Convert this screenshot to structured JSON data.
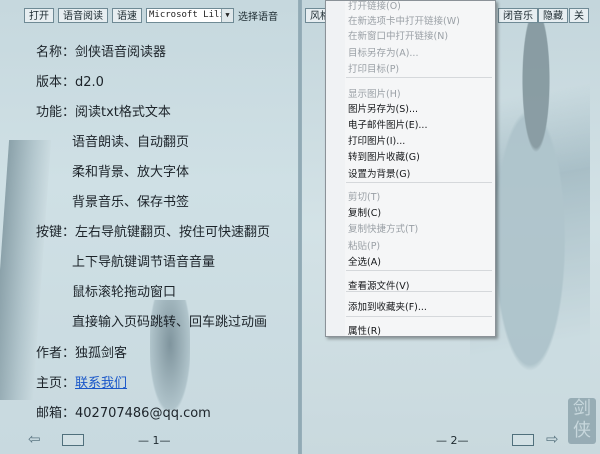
{
  "toolbar_left": {
    "open": "打开",
    "voice_read": "语音阅读",
    "speed": "语速",
    "voice_value": "Microsoft Lili",
    "voice_label": "选择语音"
  },
  "toolbar_right": {
    "style": "风格",
    "music": "闭音乐",
    "hide": "隐藏",
    "close": "关"
  },
  "info": {
    "name": "名称：剑侠语音阅读器",
    "version": "版本：d2.0",
    "features": [
      "功能：阅读txt格式文本",
      "语音朗读、自动翻页",
      "柔和背景、放大字体",
      "背景音乐、保存书签"
    ],
    "keys": [
      "按键：左右导航键翻页、按住可快速翻页",
      "上下导航键调节语音音量",
      "鼠标滚轮拖动窗口",
      "直接输入页码跳转、回车跳过动画"
    ],
    "author": "作者：独孤剑客",
    "homepage_label": "主页：",
    "homepage_link": "联系我们",
    "email": "邮箱：402707486@qq.com"
  },
  "pages": {
    "left": "— 1—",
    "right": "— 2—"
  },
  "seal_text": "剑侠",
  "context_menu": {
    "items": [
      {
        "label": "打开链接(O)",
        "enabled": false
      },
      {
        "label": "在新选项卡中打开链接(W)",
        "enabled": false
      },
      {
        "label": "在新窗口中打开链接(N)",
        "enabled": false
      },
      {
        "label": "目标另存为(A)...",
        "enabled": false
      },
      {
        "label": "打印目标(P)",
        "enabled": false
      },
      {
        "label": "显示图片(H)",
        "enabled": false
      },
      {
        "label": "图片另存为(S)...",
        "enabled": true
      },
      {
        "label": "电子邮件图片(E)...",
        "enabled": true
      },
      {
        "label": "打印图片(I)...",
        "enabled": true
      },
      {
        "label": "转到图片收藏(G)",
        "enabled": true
      },
      {
        "label": "设置为背景(G)",
        "enabled": true
      },
      {
        "label": "剪切(T)",
        "enabled": false
      },
      {
        "label": "复制(C)",
        "enabled": true
      },
      {
        "label": "复制快捷方式(T)",
        "enabled": false
      },
      {
        "label": "粘贴(P)",
        "enabled": false
      },
      {
        "label": "全选(A)",
        "enabled": true
      },
      {
        "label": "查看源文件(V)",
        "enabled": true
      },
      {
        "label": "添加到收藏夹(F)...",
        "enabled": true
      },
      {
        "label": "属性(R)",
        "enabled": true
      }
    ]
  }
}
